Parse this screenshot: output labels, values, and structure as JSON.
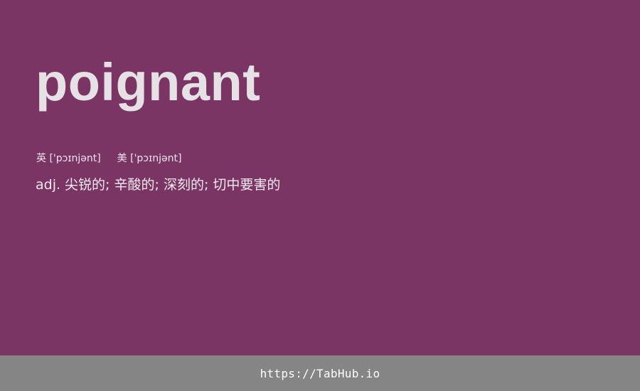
{
  "word": {
    "text": "poignant"
  },
  "phonetics": {
    "uk_label": "英",
    "uk_ipa": "['pɔɪnjənt]",
    "us_label": "美",
    "us_ipa": "['pɔɪnjənt]"
  },
  "definition": {
    "text": "adj. 尖锐的; 辛酸的; 深刻的; 切中要害的"
  },
  "footer": {
    "link_text": "https://TabHub.io"
  },
  "colors": {
    "background": "#7b3565",
    "footer_background": "#858585",
    "word_text": "#e6e1e5"
  }
}
